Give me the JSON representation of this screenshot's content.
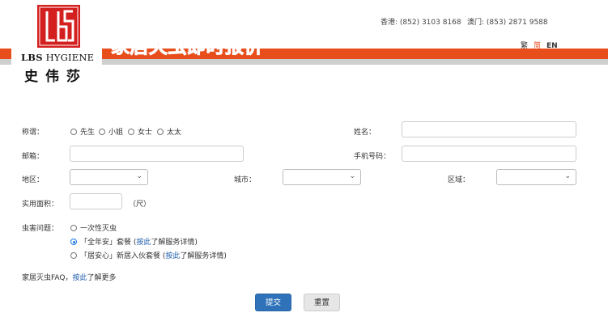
{
  "header": {
    "title": "家居灭虫即时报价",
    "logo_en_bold": "LBS",
    "logo_en_rest": " HYGIENE",
    "logo_cn": "史伟莎",
    "contact_hk": "香港: (852) 3103 8168",
    "contact_mo": "澳门: (853) 2871 9588",
    "languages": [
      "繁",
      "简",
      "EN"
    ],
    "active_language": "简",
    "brand_color": "#e84d1c"
  },
  "form": {
    "salutation": {
      "label": "称谓：",
      "options": [
        "先生",
        "小姐",
        "女士",
        "太太"
      ]
    },
    "name": {
      "label": "姓名：",
      "value": ""
    },
    "email": {
      "label": "邮箱：",
      "value": ""
    },
    "phone": {
      "label": "手机号码：",
      "value": ""
    },
    "district": {
      "label": "地区：",
      "selected": ""
    },
    "city": {
      "label": "城市：",
      "selected": ""
    },
    "area": {
      "label": "区域：",
      "selected": ""
    },
    "floor_area": {
      "label": "实用面积：",
      "value": "",
      "unit": "（尺）"
    },
    "pest_problem": {
      "label": "虫害问题：",
      "options": [
        {
          "text": "一次性灭虫",
          "selected": false
        },
        {
          "prefix": "「全年安」套餐 (",
          "link": "按此",
          "suffix": "了解服务详情)",
          "selected": true
        },
        {
          "prefix": "「居安心」新居入伙套餐 (",
          "link": "按此",
          "suffix": "了解服务详情)",
          "selected": false
        }
      ]
    },
    "faq": {
      "prefix": "家居灭虫FAQ，",
      "link": "按此",
      "suffix": "了解更多"
    },
    "submit_label": "提交",
    "reset_label": "重置"
  }
}
